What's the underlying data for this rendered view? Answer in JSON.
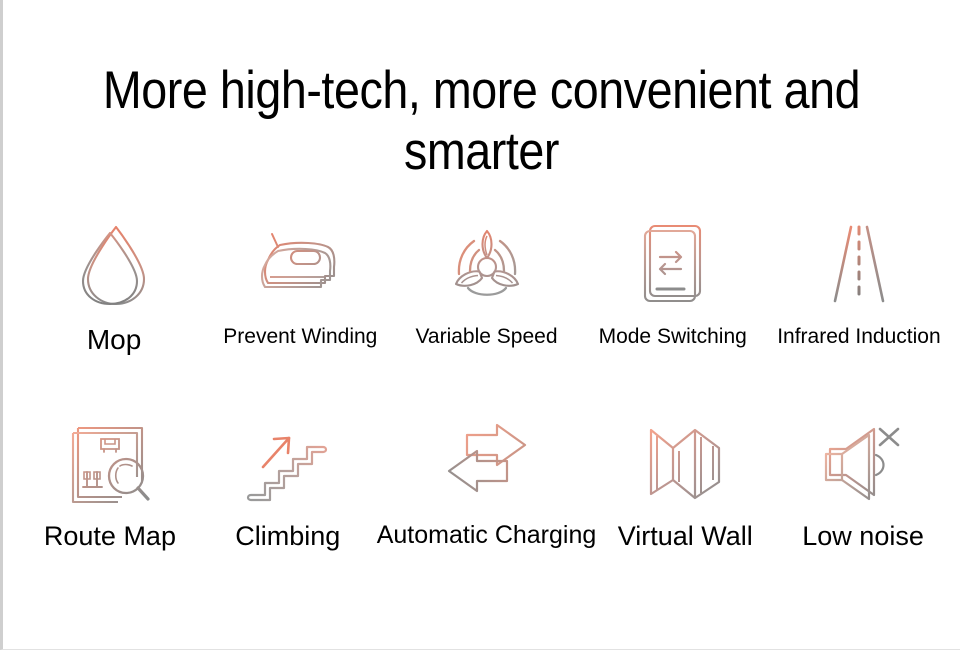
{
  "page": {
    "background_color": "#ffffff",
    "border_color": "#cfcfcf",
    "heading": "More high-tech, more convenient and\nsmarter"
  },
  "palette": {
    "accent_salmon": "#e8836a",
    "accent_light": "#f0a694",
    "neutral_gray": "#8c8c8c",
    "neutral_dark": "#6f6f6f",
    "text": "#000000"
  },
  "features": {
    "rows": [
      {
        "row_index": 1,
        "items": [
          {
            "label": "Mop",
            "icon": "water-droplet-icon"
          },
          {
            "label": "Prevent Winding",
            "icon": "clothes-iron-icon"
          },
          {
            "label": "Variable Speed",
            "icon": "fan-blades-icon"
          },
          {
            "label": "Mode Switching",
            "icon": "panel-swap-arrows-icon"
          },
          {
            "label": "Infrared Induction",
            "icon": "road-perspective-icon"
          }
        ]
      },
      {
        "row_index": 2,
        "items": [
          {
            "label": "Route Map",
            "icon": "room-map-magnifier-icon"
          },
          {
            "label": "Climbing",
            "icon": "stairs-up-arrow-icon"
          },
          {
            "label": "Automatic Charging",
            "icon": "two-way-arrows-icon"
          },
          {
            "label": "Virtual Wall",
            "icon": "folded-map-icon"
          },
          {
            "label": "Low noise",
            "icon": "speaker-mute-icon"
          }
        ]
      }
    ]
  }
}
